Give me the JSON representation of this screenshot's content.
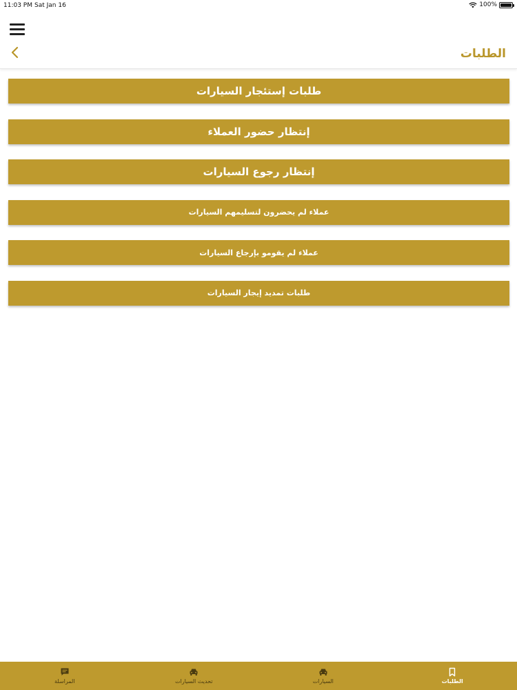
{
  "status_bar": {
    "time": "11:03 PM",
    "date": "Sat Jan 16",
    "battery": "100%",
    "battery_level": 1.0
  },
  "header": {
    "title": "الطلبات",
    "menu_icon": "hamburger-menu-icon",
    "back_icon": "chevron-left-icon"
  },
  "colors": {
    "accent": "#be9a2e",
    "title": "#b9962a",
    "tab_inactive": "#4a3b10"
  },
  "menu": [
    {
      "label": "طلبات إستئجار السيارات"
    },
    {
      "label": "إنتظار حضور العملاء"
    },
    {
      "label": "إنتظار رجوع السيارات"
    },
    {
      "label": "عملاء لم يحضرون لتسليمهم السيارات"
    },
    {
      "label": "عملاء لم يقومو بإرجاع السيارات"
    },
    {
      "label": "طلبات تمديد إيجار السيارات"
    }
  ],
  "tabs": [
    {
      "label": "الطلبات",
      "icon": "bookmark-icon",
      "active": true
    },
    {
      "label": "السيارات",
      "icon": "car-icon",
      "active": false
    },
    {
      "label": "تحديث السيارات",
      "icon": "car-icon",
      "active": false
    },
    {
      "label": "المراسلة",
      "icon": "chat-icon",
      "active": false
    }
  ]
}
